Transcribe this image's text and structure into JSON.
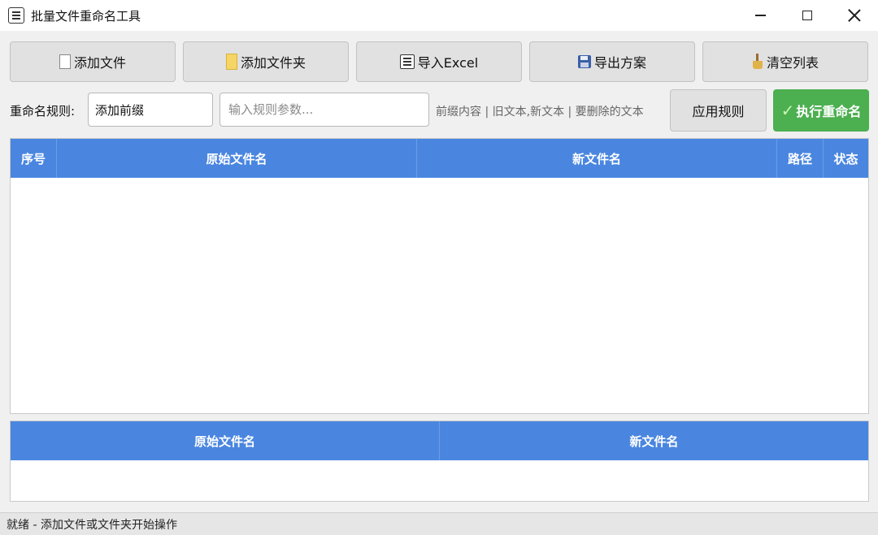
{
  "window": {
    "title": "批量文件重命名工具"
  },
  "toolbar": {
    "add_file": "添加文件",
    "add_folder": "添加文件夹",
    "import_excel": "导入Excel",
    "export_plan": "导出方案",
    "clear_list": "清空列表"
  },
  "rule": {
    "label": "重命名规则:",
    "selected": "添加前缀",
    "param_placeholder": "输入规则参数...",
    "hint": "前缀内容 | 旧文本,新文本 | 要删除的文本",
    "apply_label": "应用规则",
    "execute_label": "执行重命名"
  },
  "file_table": {
    "columns": [
      "序号",
      "原始文件名",
      "新文件名",
      "路径",
      "状态"
    ],
    "rows": []
  },
  "preview_table": {
    "columns": [
      "原始文件名",
      "新文件名"
    ],
    "rows": []
  },
  "status": {
    "text": "就绪 - 添加文件或文件夹开始操作"
  },
  "colors": {
    "header_blue": "#4a86e0",
    "execute_green": "#4caf50"
  }
}
